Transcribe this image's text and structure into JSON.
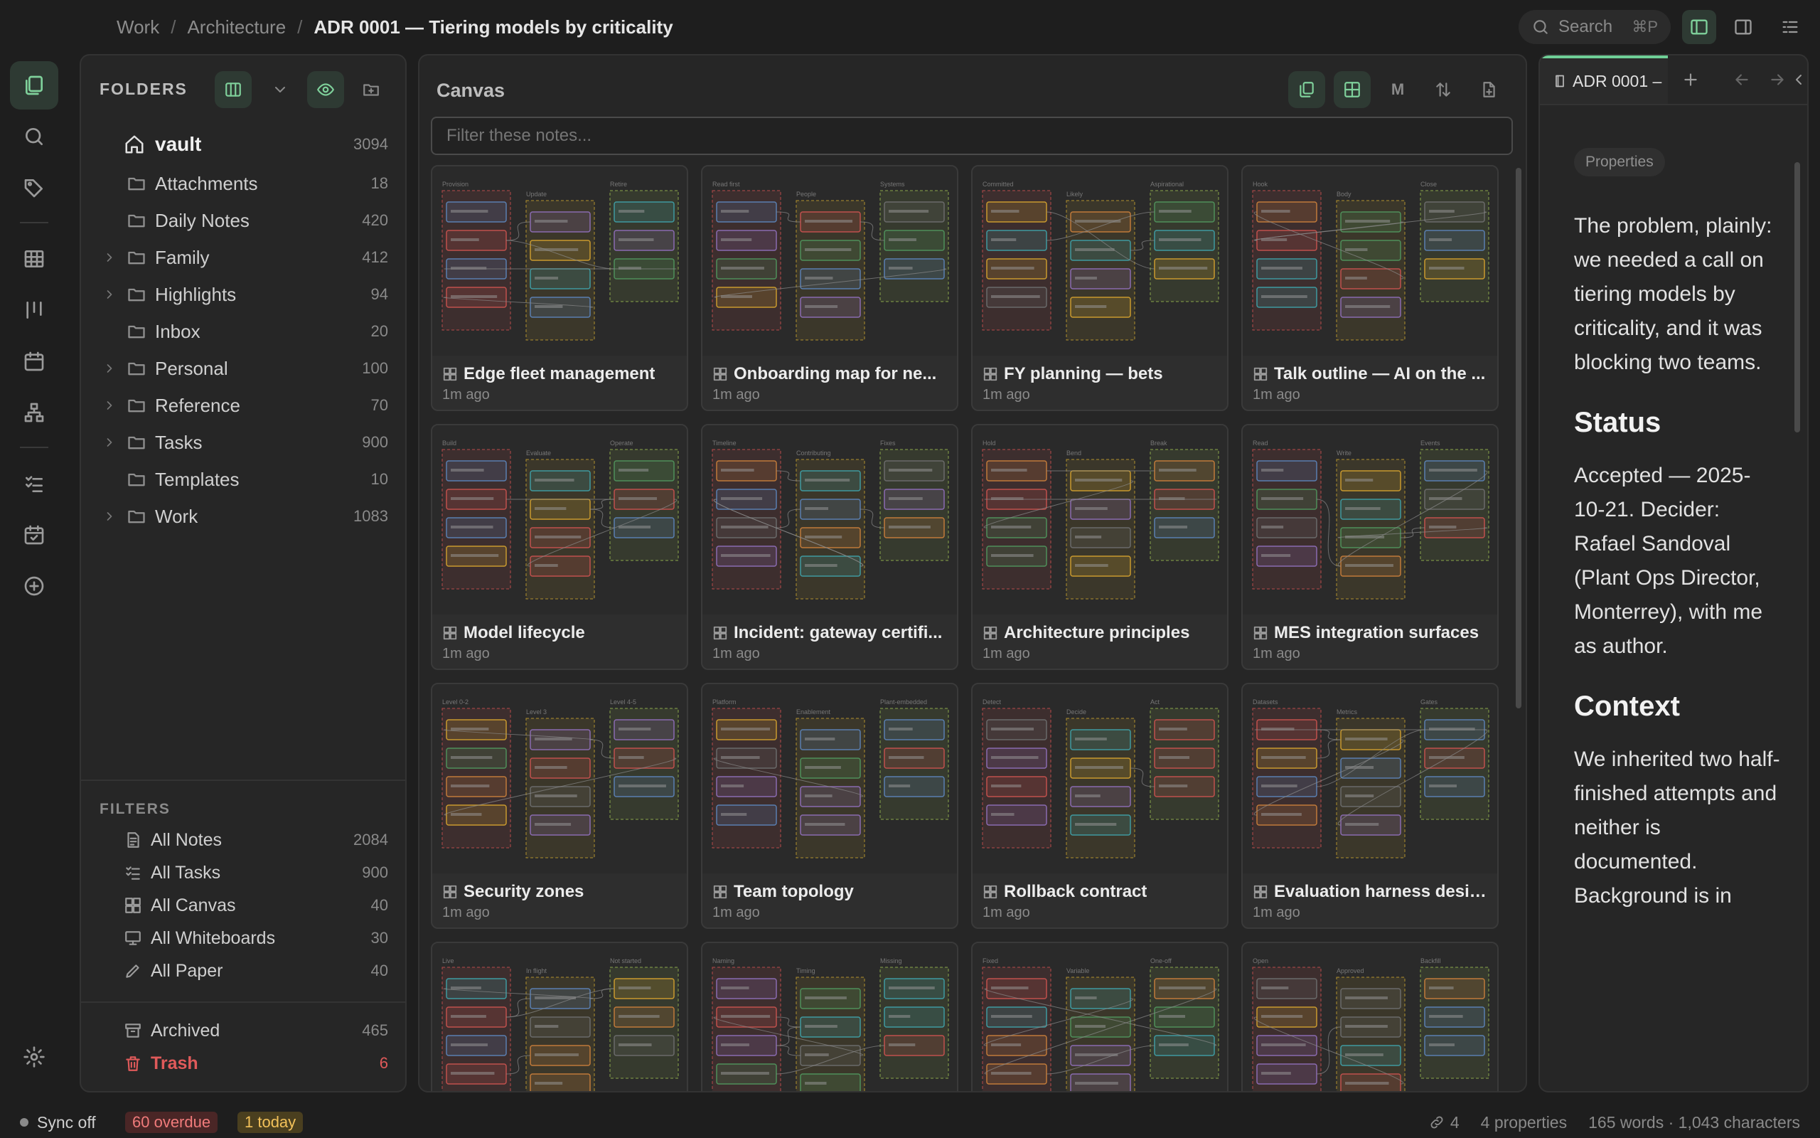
{
  "breadcrumb": {
    "items": [
      "Work",
      "Architecture"
    ],
    "current": "ADR 0001 — Tiering models by criticality"
  },
  "search": {
    "placeholder": "Search",
    "shortcut": "⌘P"
  },
  "folders": {
    "title": "FOLDERS",
    "vault": {
      "label": "vault",
      "count": "3094"
    },
    "items": [
      {
        "label": "Attachments",
        "count": "18",
        "expandable": false
      },
      {
        "label": "Daily Notes",
        "count": "420",
        "expandable": false
      },
      {
        "label": "Family",
        "count": "412",
        "expandable": true
      },
      {
        "label": "Highlights",
        "count": "94",
        "expandable": true
      },
      {
        "label": "Inbox",
        "count": "20",
        "expandable": false
      },
      {
        "label": "Personal",
        "count": "100",
        "expandable": true
      },
      {
        "label": "Reference",
        "count": "70",
        "expandable": true
      },
      {
        "label": "Tasks",
        "count": "900",
        "expandable": true
      },
      {
        "label": "Templates",
        "count": "10",
        "expandable": false
      },
      {
        "label": "Work",
        "count": "1083",
        "expandable": true
      }
    ]
  },
  "filters": {
    "title": "FILTERS",
    "items": [
      {
        "label": "All Notes",
        "count": "2084",
        "icon": "note-icon"
      },
      {
        "label": "All Tasks",
        "count": "900",
        "icon": "tasks-icon"
      },
      {
        "label": "All Canvas",
        "count": "40",
        "icon": "canvas-icon"
      },
      {
        "label": "All Whiteboards",
        "count": "30",
        "icon": "whiteboard-icon"
      },
      {
        "label": "All Paper",
        "count": "40",
        "icon": "pen-icon"
      }
    ],
    "archived": {
      "label": "Archived",
      "count": "465"
    },
    "trash": {
      "label": "Trash",
      "count": "6"
    }
  },
  "canvas": {
    "title": "Canvas",
    "size_button": "M",
    "filter_placeholder": "Filter these notes...",
    "cards": [
      {
        "title": "Edge fleet management",
        "time": "1m ago",
        "cols": [
          "Provision",
          "Update",
          "Retire"
        ]
      },
      {
        "title": "Onboarding map for ne...",
        "time": "1m ago",
        "cols": [
          "Read first",
          "People",
          "Systems"
        ]
      },
      {
        "title": "FY planning — bets",
        "time": "1m ago",
        "cols": [
          "Committed",
          "Likely",
          "Aspirational"
        ]
      },
      {
        "title": "Talk outline — AI on the ...",
        "time": "1m ago",
        "cols": [
          "Hook",
          "Body",
          "Close"
        ]
      },
      {
        "title": "Model lifecycle",
        "time": "1m ago",
        "cols": [
          "Build",
          "Evaluate",
          "Operate"
        ]
      },
      {
        "title": "Incident: gateway certifi...",
        "time": "1m ago",
        "cols": [
          "Timeline",
          "Contributing",
          "Fixes"
        ]
      },
      {
        "title": "Architecture principles",
        "time": "1m ago",
        "cols": [
          "Hold",
          "Bend",
          "Break"
        ]
      },
      {
        "title": "MES integration surfaces",
        "time": "1m ago",
        "cols": [
          "Read",
          "Write",
          "Events"
        ]
      },
      {
        "title": "Security zones",
        "time": "1m ago",
        "cols": [
          "Level 0-2",
          "Level 3",
          "Level 4-5"
        ]
      },
      {
        "title": "Team topology",
        "time": "1m ago",
        "cols": [
          "Platform",
          "Enablement",
          "Plant-embedded"
        ]
      },
      {
        "title": "Rollback contract",
        "time": "1m ago",
        "cols": [
          "Detect",
          "Decide",
          "Act"
        ]
      },
      {
        "title": "Evaluation harness design",
        "time": "1m ago",
        "cols": [
          "Datasets",
          "Metrics",
          "Gates"
        ]
      },
      {
        "title": "",
        "time": "",
        "cols": [
          "Live",
          "In flight",
          "Not started"
        ]
      },
      {
        "title": "",
        "time": "",
        "cols": [
          "Naming",
          "Timing",
          "Missing"
        ]
      },
      {
        "title": "",
        "time": "",
        "cols": [
          "Fixed",
          "Variable",
          "One-off"
        ]
      },
      {
        "title": "",
        "time": "",
        "cols": [
          "Open",
          "Approved",
          "Backfill"
        ]
      }
    ]
  },
  "note": {
    "tab_label": "ADR 0001 –",
    "properties_label": "Properties",
    "intro": "The problem, plainly: we needed a call on tiering models by criticality, and it was blocking two teams.",
    "status_heading": "Status",
    "status_text": "Accepted — 2025-10-21. Decider: Rafael Sandoval (Plant Ops Director, Monterrey), with me as author.",
    "context_heading": "Context",
    "context_text": "We inherited two half-finished attempts and neither is documented. Background is in"
  },
  "status_bar": {
    "sync": "Sync off",
    "overdue": "60 overdue",
    "today": "1 today",
    "links": "4",
    "properties": "4 properties",
    "words": "165 words · 1,043 characters"
  },
  "colors": {
    "accent": "#7fd19b",
    "danger": "#e05a5a",
    "warning": "#f2c15a"
  }
}
